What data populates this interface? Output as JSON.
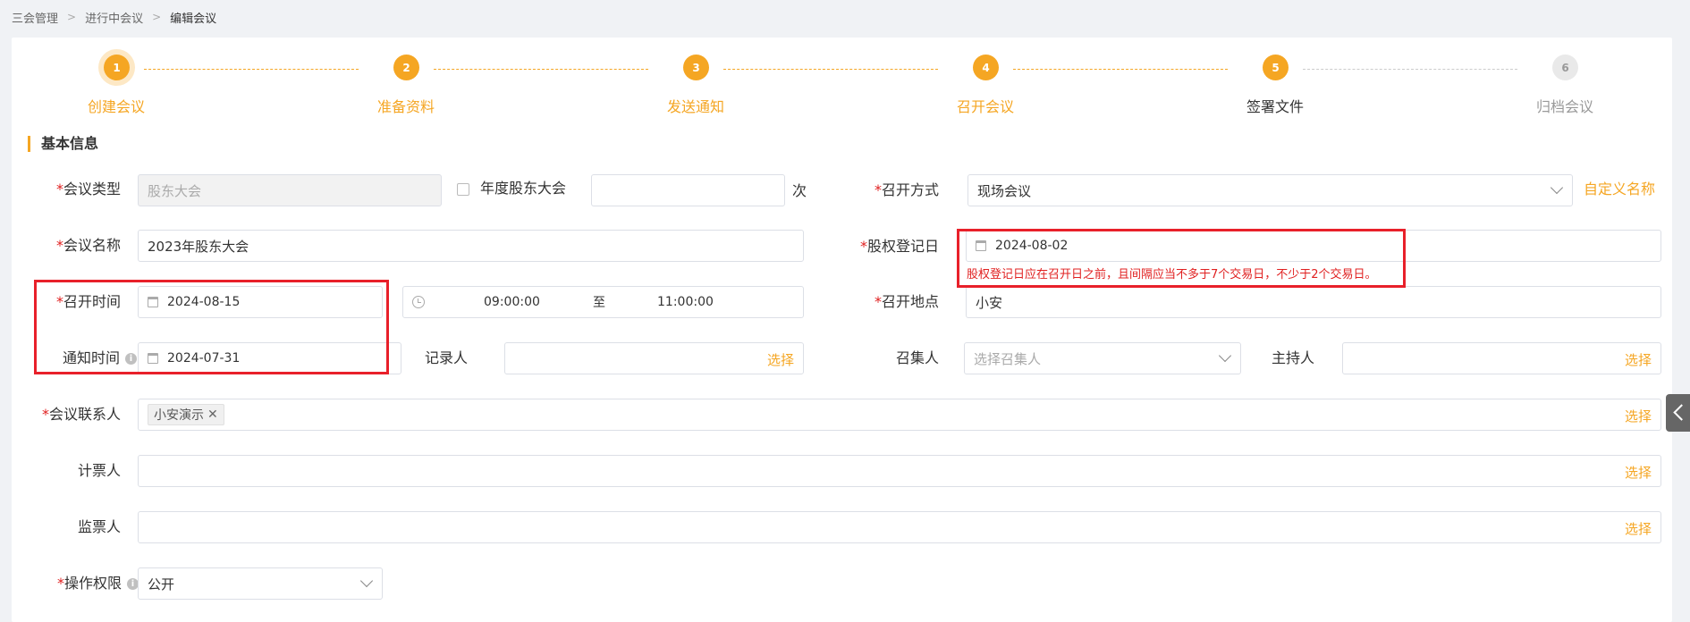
{
  "breadcrumb": [
    "三会管理",
    "进行中会议",
    "编辑会议"
  ],
  "steps": [
    {
      "num": "1",
      "label": "创建会议"
    },
    {
      "num": "2",
      "label": "准备资料"
    },
    {
      "num": "3",
      "label": "发送通知"
    },
    {
      "num": "4",
      "label": "召开会议"
    },
    {
      "num": "5",
      "label": "签署文件"
    },
    {
      "num": "6",
      "label": "归档会议"
    }
  ],
  "section_title": "基本信息",
  "form": {
    "meeting_type": {
      "label": "会议类型",
      "value": "股东大会"
    },
    "annual_checkbox_label": "年度股东大会",
    "times_unit": "次",
    "method": {
      "label": "召开方式",
      "value": "现场会议",
      "custom_link": "自定义名称"
    },
    "meeting_name": {
      "label": "会议名称",
      "value": "2023年股东大会"
    },
    "record_date": {
      "label": "股权登记日",
      "value": "2024-08-02",
      "error": "股权登记日应在召开日之前，且间隔应当不多于7个交易日，不少于2个交易日。"
    },
    "meeting_time": {
      "label": "召开时间",
      "date": "2024-08-15",
      "start": "09:00:00",
      "to": "至",
      "end": "11:00:00"
    },
    "location": {
      "label": "召开地点",
      "value": "小安"
    },
    "notice_time": {
      "label": "通知时间",
      "value": "2024-07-31"
    },
    "recorder": {
      "label": "记录人",
      "link": "选择"
    },
    "convener": {
      "label": "召集人",
      "placeholder": "选择召集人"
    },
    "host": {
      "label": "主持人",
      "link": "选择"
    },
    "contact": {
      "label": "会议联系人",
      "tag": "小安演示",
      "link": "选择"
    },
    "counter": {
      "label": "计票人",
      "link": "选择"
    },
    "scrutineer": {
      "label": "监票人",
      "link": "选择"
    },
    "permission": {
      "label": "操作权限",
      "value": "公开"
    }
  },
  "colors": {
    "accent": "#f5a623",
    "error": "#e02020"
  }
}
